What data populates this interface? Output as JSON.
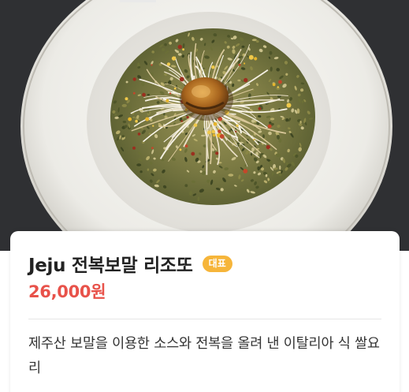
{
  "menu_item": {
    "name": "Jeju 전복보말 리조또",
    "badge": "대표",
    "price": "26,000원",
    "description": "제주산 보말을 이용한 소스와 전복을 올려 낸 이탈리아 식 쌀요리"
  },
  "colors": {
    "price": "#e8524a",
    "badge_bg": "#f6b53a",
    "photo_bg": "#2f3033"
  }
}
